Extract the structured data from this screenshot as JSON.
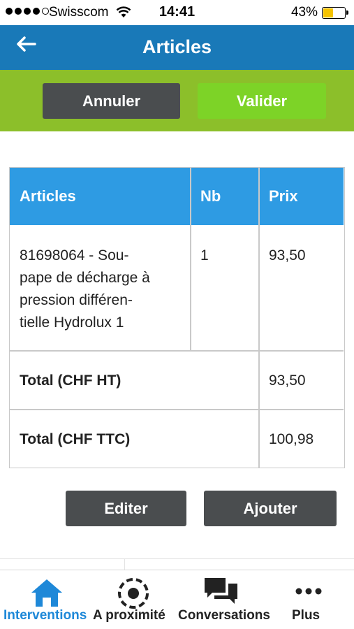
{
  "status_bar": {
    "carrier": "Swisscom",
    "time": "14:41",
    "battery": "43%"
  },
  "nav": {
    "title": "Articles",
    "back_icon": "arrow-left-icon"
  },
  "actions": {
    "cancel_label": "Annuler",
    "validate_label": "Valider"
  },
  "table": {
    "headers": [
      "Articles",
      "Nb",
      "Prix"
    ],
    "item": {
      "description_lines": [
        "81698064 - Sou-",
        "pape de décharge à",
        "pression différen-",
        "tielle Hydrolux 1"
      ],
      "quantity": "1",
      "price": "93,50"
    },
    "totals": [
      {
        "label": "Total (CHF HT)",
        "value": "93,50"
      },
      {
        "label": "Total (CHF TTC)",
        "value": "100,98"
      }
    ]
  },
  "buttons": {
    "edit_label": "Editer",
    "add_label": "Ajouter"
  },
  "tabs": [
    {
      "label": "Interventions",
      "icon": "home-icon",
      "active": true
    },
    {
      "label": "A proximité",
      "icon": "location-target-icon",
      "active": false
    },
    {
      "label": "Conversations",
      "icon": "chat-bubbles-icon",
      "active": false
    },
    {
      "label": "Plus",
      "icon": "more-dots-icon",
      "active": false
    }
  ],
  "colors": {
    "nav_blue": "#1979b8",
    "header_blue": "#2e9be3",
    "action_green": "#8cbf2a",
    "validate_green": "#7dd327",
    "button_gray": "#4a4d4f",
    "active_tab_blue": "#1e88d8"
  }
}
